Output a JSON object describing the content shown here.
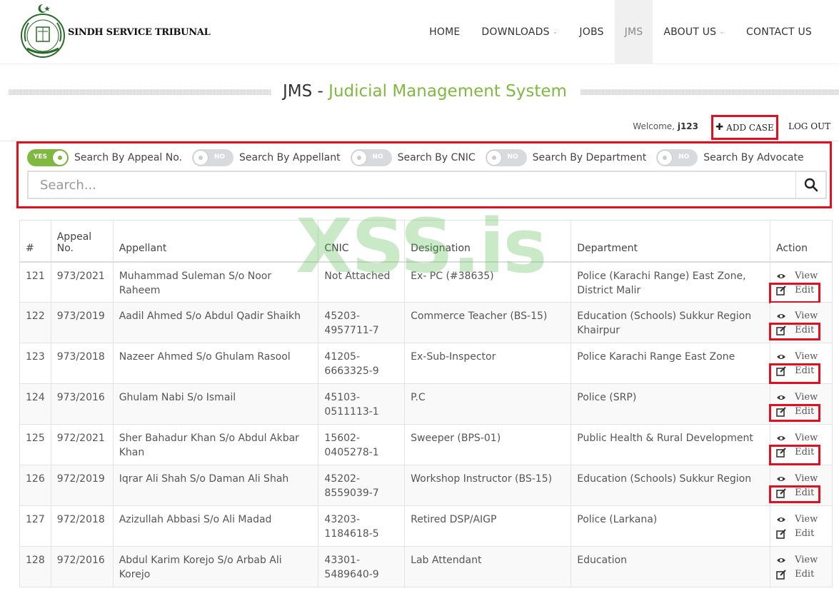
{
  "brand": {
    "name": "SINDH SERVICE TRIBUNAL"
  },
  "nav": [
    {
      "label": "HOME",
      "dropdown": false,
      "active": false
    },
    {
      "label": "DOWNLOADS",
      "dropdown": true,
      "active": false
    },
    {
      "label": "JOBS",
      "dropdown": false,
      "active": false
    },
    {
      "label": "JMS",
      "dropdown": false,
      "active": true
    },
    {
      "label": "ABOUT US",
      "dropdown": true,
      "active": false
    },
    {
      "label": "CONTACT US",
      "dropdown": false,
      "active": false
    }
  ],
  "page": {
    "title_prefix": "JMS - ",
    "title_main": "Judicial Management System"
  },
  "user": {
    "welcome": "Welcome,",
    "name": "j123",
    "add_case": "ADD CASE",
    "logout": "LOG OUT"
  },
  "filters": [
    {
      "state": "YES",
      "on": true,
      "label": "Search By Appeal No."
    },
    {
      "state": "NO",
      "on": false,
      "label": "Search By Appellant"
    },
    {
      "state": "NO",
      "on": false,
      "label": "Search By CNIC"
    },
    {
      "state": "NO",
      "on": false,
      "label": "Search By Department"
    },
    {
      "state": "NO",
      "on": false,
      "label": "Search By Advocate"
    }
  ],
  "search": {
    "placeholder": "Search..."
  },
  "table": {
    "headers": {
      "num": "#",
      "appeal": "Appeal No.",
      "appellant": "Appellant",
      "cnic": "CNIC",
      "designation": "Designation",
      "department": "Department",
      "action": "Action"
    },
    "view_label": "View",
    "edit_label": "Edit",
    "rows": [
      {
        "num": "121",
        "appeal": "973/2021",
        "appellant": "Muhammad Suleman S/o Noor Raheem",
        "cnic": "Not Attached",
        "designation": "Ex- PC (#38635)",
        "department": "Police (Karachi Range) East Zone, District Malir",
        "edit_highlight": true
      },
      {
        "num": "122",
        "appeal": "973/2019",
        "appellant": "Aadil Ahmed S/o Abdul Qadir Shaikh",
        "cnic": "45203-4957711-7",
        "designation": "Commerce Teacher (BS-15)",
        "department": "Education (Schools) Sukkur Region Khairpur",
        "edit_highlight": true
      },
      {
        "num": "123",
        "appeal": "973/2018",
        "appellant": "Nazeer Ahmed S/o Ghulam Rasool",
        "cnic": "41205-6663325-9",
        "designation": "Ex-Sub-Inspector",
        "department": "Police Karachi Range East Zone",
        "edit_highlight": true
      },
      {
        "num": "124",
        "appeal": "973/2016",
        "appellant": "Ghulam Nabi S/o Ismail",
        "cnic": "45103-0511113-1",
        "designation": "P.C",
        "department": "Police (SRP)",
        "edit_highlight": true
      },
      {
        "num": "125",
        "appeal": "972/2021",
        "appellant": "Sher Bahadur Khan S/o Abdul Akbar Khan",
        "cnic": "15602-0405278-1",
        "designation": "Sweeper (BPS-01)",
        "department": "Public Health & Rural Development",
        "edit_highlight": true
      },
      {
        "num": "126",
        "appeal": "972/2019",
        "appellant": "Iqrar Ali Shah S/o Daman Ali Shah",
        "cnic": "45202-8559039-7",
        "designation": "Workshop Instructor (BS-15)",
        "department": "Education (Schools) Sukkur Region",
        "edit_highlight": true
      },
      {
        "num": "127",
        "appeal": "972/2018",
        "appellant": "Azizullah Abbasi S/o Ali Madad",
        "cnic": "43203-1184618-5",
        "designation": "Retired DSP/AIGP",
        "department": "Police (Larkana)",
        "edit_highlight": false
      },
      {
        "num": "128",
        "appeal": "972/2016",
        "appellant": "Abdul Karim Korejo S/o Arbab Ali Korejo",
        "cnic": "43301-5489640-9",
        "designation": "Lab Attendant",
        "department": "Education",
        "edit_highlight": false
      }
    ]
  },
  "watermark": "XSS.is",
  "colors": {
    "accent_green": "#7fb940",
    "highlight_red": "#e01020",
    "nav_active_bg": "#f0f0f0"
  }
}
